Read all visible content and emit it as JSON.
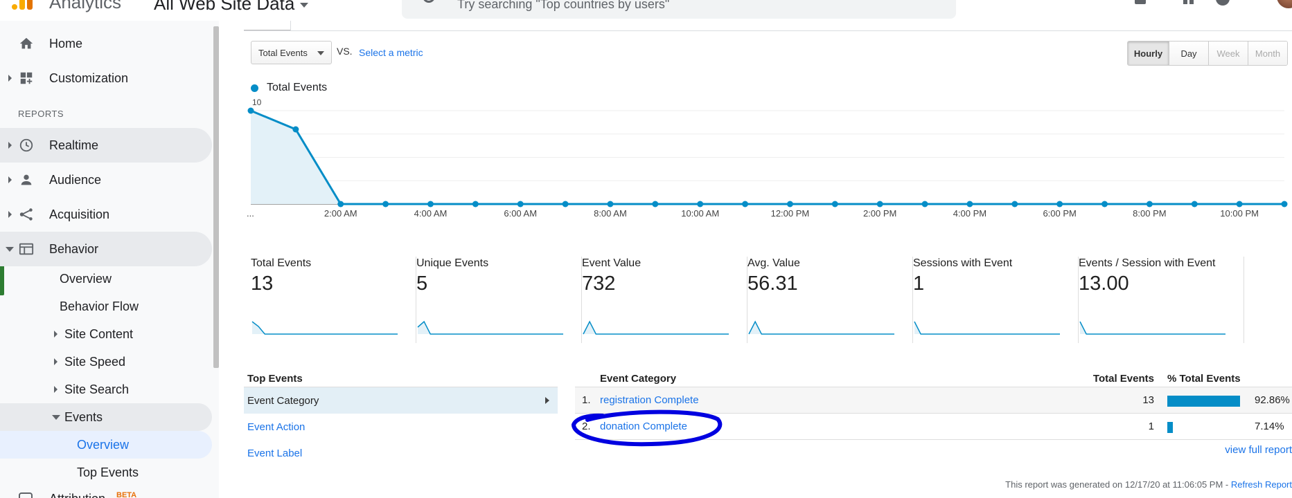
{
  "header": {
    "app_name": "Analytics",
    "property": "All Web Site Data",
    "search_placeholder": "Try searching \"Top countries by users\""
  },
  "sidebar": {
    "home": "Home",
    "customization": "Customization",
    "section_reports": "REPORTS",
    "realtime": "Realtime",
    "audience": "Audience",
    "acquisition": "Acquisition",
    "behavior": "Behavior",
    "behavior_items": {
      "overview": "Overview",
      "behavior_flow": "Behavior Flow",
      "site_content": "Site Content",
      "site_speed": "Site Speed",
      "site_search": "Site Search",
      "events": "Events",
      "events_overview": "Overview",
      "top_events": "Top Events"
    },
    "attribution": "Attribution",
    "beta": "BETA"
  },
  "controls": {
    "metric": "Total Events",
    "vs": "VS.",
    "select_metric": "Select a metric",
    "granularity": [
      "Hourly",
      "Day",
      "Week",
      "Month"
    ],
    "granularity_selected": "Hourly"
  },
  "chart_data": {
    "type": "line",
    "series": [
      {
        "name": "Total Events",
        "values": [
          10,
          8,
          0,
          0,
          0,
          0,
          0,
          0,
          0,
          0,
          0,
          0,
          0,
          0,
          0,
          0,
          0,
          0,
          0,
          0,
          0,
          0,
          0,
          0
        ]
      }
    ],
    "x_tick_labels": [
      "...",
      "2:00 AM",
      "4:00 AM",
      "6:00 AM",
      "8:00 AM",
      "10:00 AM",
      "12:00 PM",
      "2:00 PM",
      "4:00 PM",
      "6:00 PM",
      "8:00 PM",
      "10:00 PM"
    ],
    "y_ticks": [
      5,
      10
    ],
    "ylim": [
      0,
      10
    ],
    "grid": true,
    "color": "#058dc7",
    "fill": "#e3f1f8"
  },
  "scorecards": [
    {
      "label": "Total Events",
      "value": "13"
    },
    {
      "label": "Unique Events",
      "value": "5"
    },
    {
      "label": "Event Value",
      "value": "732"
    },
    {
      "label": "Avg. Value",
      "value": "56.31"
    },
    {
      "label": "Sessions with Event",
      "value": "1"
    },
    {
      "label": "Events / Session with Event",
      "value": "13.00"
    }
  ],
  "top_events": {
    "title": "Top Events",
    "rows": [
      "Event Category",
      "Event Action",
      "Event Label"
    ]
  },
  "event_table": {
    "headers": {
      "category": "Event Category",
      "total": "Total Events",
      "pct": "% Total Events"
    },
    "rows": [
      {
        "num": "1.",
        "name": "registration Complete",
        "total": "13",
        "pct": "92.86%",
        "share": 0.9286
      },
      {
        "num": "2.",
        "name": "donation Complete",
        "total": "1",
        "pct": "7.14%",
        "share": 0.0714
      }
    ]
  },
  "view_full": "view full report",
  "report_note": "This report was generated on 12/17/20 at 11:06:05 PM - ",
  "refresh": "Refresh Report"
}
